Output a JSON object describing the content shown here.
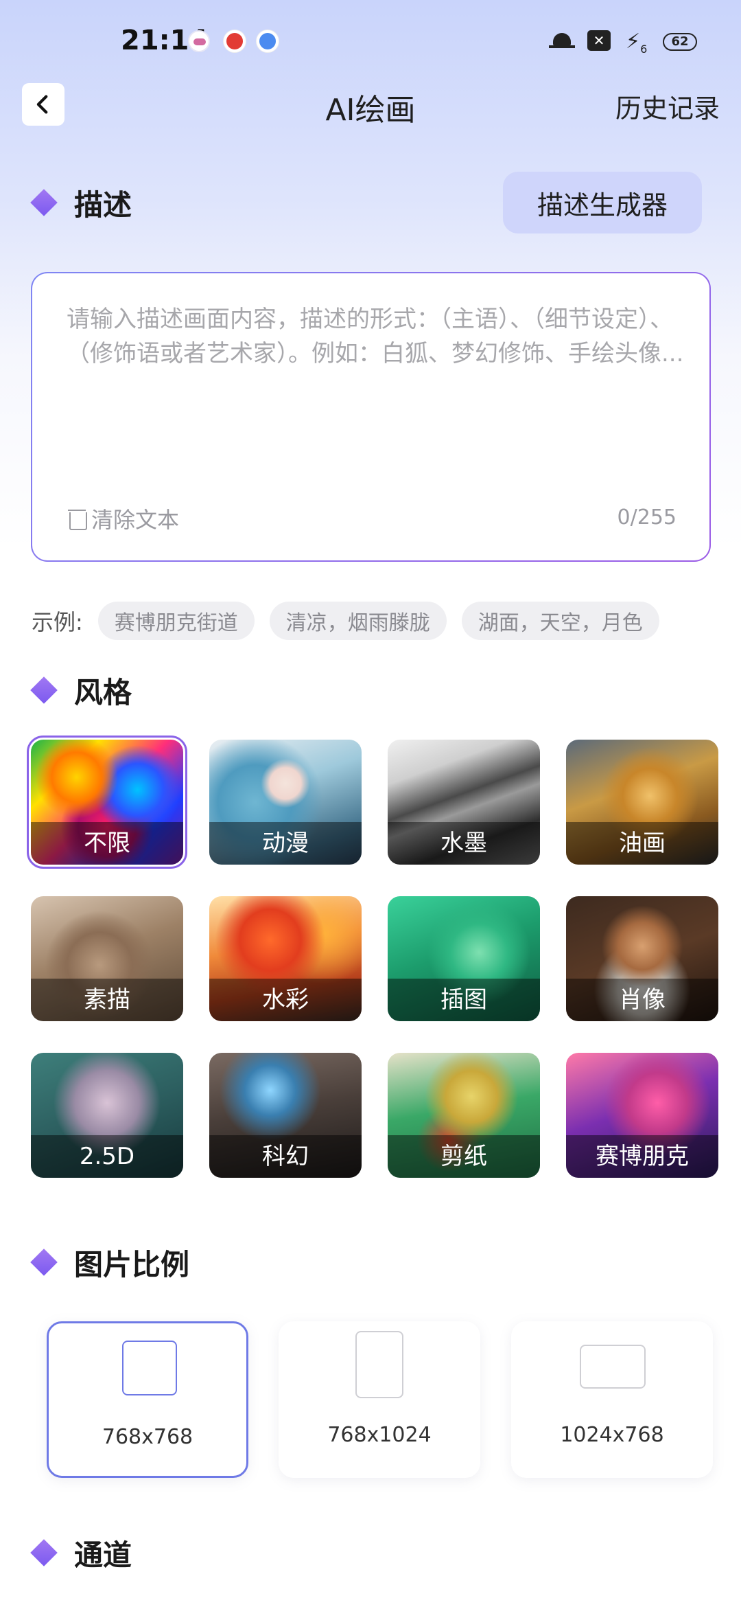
{
  "status_bar": {
    "time": "21:14",
    "sim": "✕",
    "network_sub": "6",
    "battery": "62"
  },
  "header": {
    "title": "AI绘画",
    "history": "历史记录"
  },
  "description": {
    "section_title": "描述",
    "generator_button": "描述生成器",
    "placeholder": "请输入描述画面内容，描述的形式：（主语）、（细节设定）、（修饰语或者艺术家）。例如：白狐、梦幻修饰、手绘头像...",
    "clear_label": "清除文本",
    "count": "0/255"
  },
  "examples": {
    "label": "示例:",
    "chips": [
      "赛博朋克街道",
      "清凉，烟雨滕胧",
      "湖面，天空，月色"
    ]
  },
  "style": {
    "section_title": "风格",
    "items": [
      {
        "label": "不限",
        "selected": true
      },
      {
        "label": "动漫"
      },
      {
        "label": "水墨"
      },
      {
        "label": "油画"
      },
      {
        "label": "素描"
      },
      {
        "label": "水彩"
      },
      {
        "label": "插图"
      },
      {
        "label": "肖像"
      },
      {
        "label": "2.5D"
      },
      {
        "label": "科幻"
      },
      {
        "label": "剪纸"
      },
      {
        "label": "赛博朋克"
      }
    ]
  },
  "ratio": {
    "section_title": "图片比例",
    "options": [
      {
        "label": "768x768",
        "selected": true
      },
      {
        "label": "768x1024"
      },
      {
        "label": "1024x768"
      }
    ]
  },
  "channel": {
    "section_title": "通道"
  },
  "colors": {
    "accent": "#7c5af0",
    "selected_border": "#6f7ae6"
  }
}
